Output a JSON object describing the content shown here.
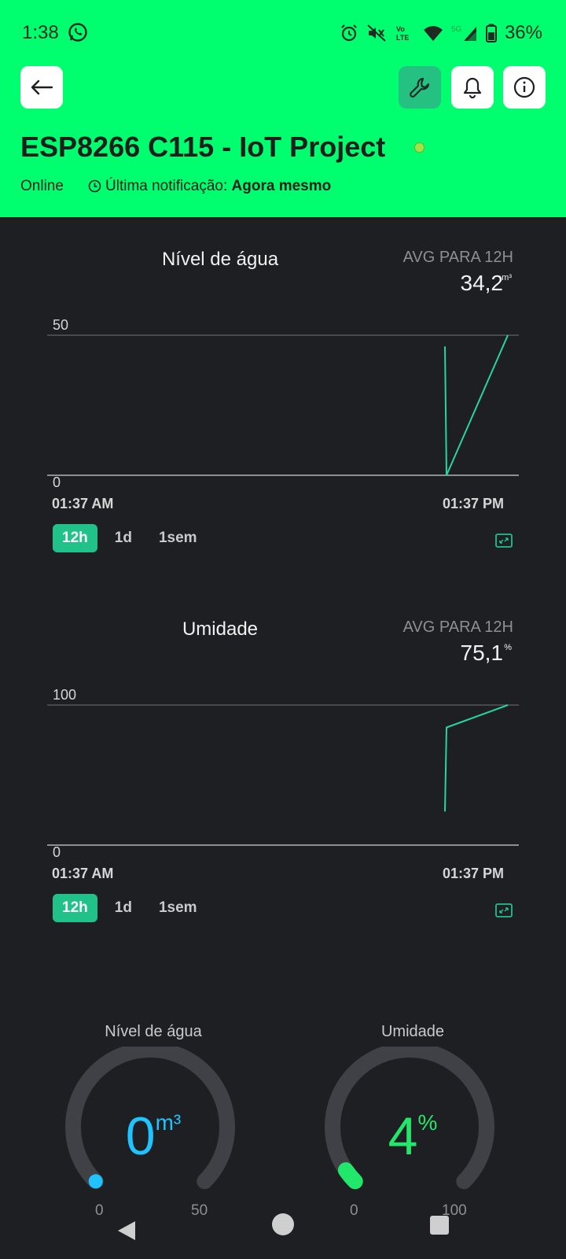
{
  "status_bar": {
    "time": "1:38",
    "battery": "36%",
    "icons": [
      "whatsapp-icon",
      "alarm-icon",
      "mute-icon",
      "volte-icon",
      "wifi-icon",
      "signal-5g-icon",
      "battery-icon"
    ]
  },
  "header": {
    "device_name": "ESP8266 C115 - IoT Project",
    "status": "Online",
    "last_notification_label": "Última notificação:",
    "last_notification_value": "Agora mesmo",
    "background": "#00ff6e",
    "buttons": [
      "back-arrow-icon",
      "wrench-icon",
      "bell-icon",
      "info-icon"
    ]
  },
  "charts": [
    {
      "title": "Nível de água",
      "avg_label": "AVG PARA 12H",
      "avg_value": "34,2",
      "unit": "m³",
      "y_top_label": "50",
      "y_bottom_label": "0",
      "x_start_label": "01:37 AM",
      "x_end_label": "01:37 PM",
      "tabs": [
        "12h",
        "1d",
        "1sem"
      ],
      "active_tab": "12h"
    },
    {
      "title": "Umidade",
      "avg_label": "AVG PARA 12H",
      "avg_value": "75,1",
      "unit": "%",
      "y_top_label": "100",
      "y_bottom_label": "0",
      "x_start_label": "01:37 AM",
      "x_end_label": "01:37 PM",
      "tabs": [
        "12h",
        "1d",
        "1sem"
      ],
      "active_tab": "12h"
    }
  ],
  "chart_data": [
    {
      "type": "line",
      "ylim": [
        0,
        50
      ],
      "series": [
        {
          "values": [
            46,
            0,
            50
          ]
        }
      ],
      "color": "#26d6a0"
    },
    {
      "type": "line",
      "ylim": [
        0,
        100
      ],
      "series": [
        {
          "values": [
            24,
            84,
            100
          ]
        }
      ],
      "color": "#26d6a0"
    }
  ],
  "gauges": [
    {
      "title": "Nível de água",
      "value": "0",
      "unit": "m³",
      "min": "0",
      "max": "50",
      "fraction": 0,
      "color": "#1fc3ff"
    },
    {
      "title": "Umidade",
      "value": "4",
      "unit": "%",
      "min": "0",
      "max": "100",
      "fraction": 0.04,
      "color": "#21e86b"
    }
  ]
}
